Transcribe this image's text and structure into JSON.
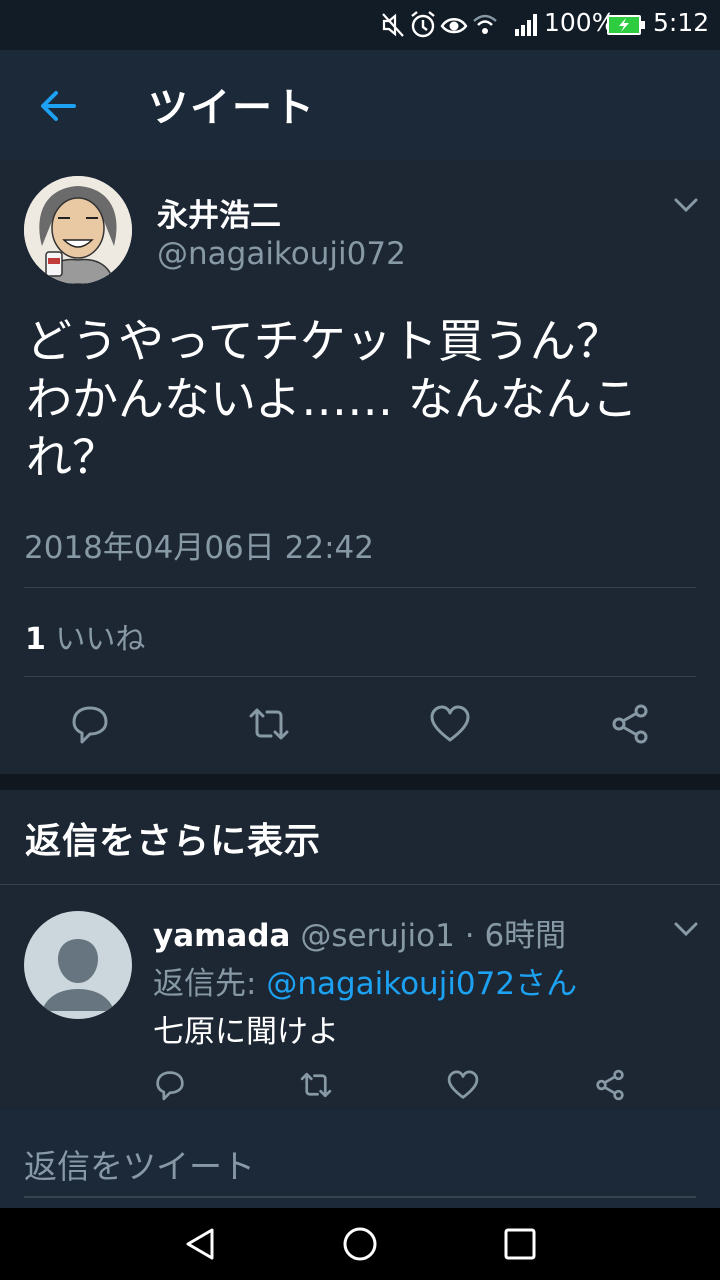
{
  "status_bar": {
    "battery_text": "100%",
    "time": "5:12"
  },
  "header": {
    "title": "ツイート"
  },
  "tweet": {
    "author_name": "永井浩二",
    "author_handle": "@nagaikouji072",
    "text_line1": "どうやってチケット買うん？",
    "text_line2": "わかんないよ…… なんなんこ",
    "text_line3": "れ？",
    "timestamp": "2018年04月06日 22:42",
    "likes_count": "1",
    "likes_label": "いいね"
  },
  "more_replies": {
    "label": "返信をさらに表示"
  },
  "reply": {
    "user_name": "yamada",
    "user_handle": "@serujio1",
    "separator": "·",
    "time_ago": "6時間",
    "reply_to_label": "返信先:",
    "reply_to_handle": "@nagaikouji072さん",
    "text": "七原に聞けよ"
  },
  "composer": {
    "placeholder": "返信をツイート"
  },
  "icons": {
    "back": "arrow-left-icon",
    "chevron": "chevron-down-icon",
    "reply": "reply-icon",
    "retweet": "retweet-icon",
    "like": "heart-icon",
    "share": "share-icon",
    "nav_back": "triangle-back-icon",
    "nav_home": "circle-home-icon",
    "nav_recent": "square-recent-icon"
  },
  "colors": {
    "background": "#15202b",
    "accent": "#1da1f2",
    "muted": "#8899a6",
    "battery": "#2ecc40"
  }
}
